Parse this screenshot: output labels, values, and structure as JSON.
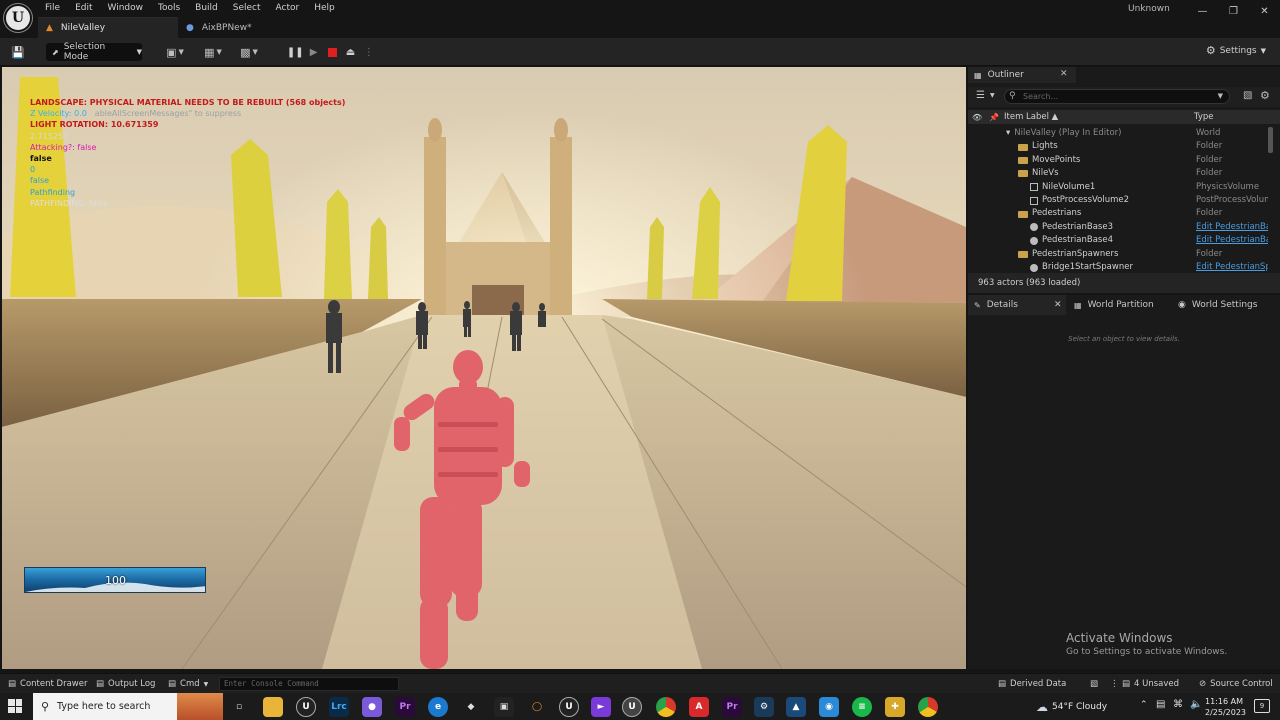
{
  "menu": {
    "items": [
      "File",
      "Edit",
      "Window",
      "Tools",
      "Build",
      "Select",
      "Actor",
      "Help"
    ],
    "window_title": "Unknown"
  },
  "tabs": [
    {
      "label": "NileValley",
      "active": true
    },
    {
      "label": "AixBPNew*",
      "active": false
    }
  ],
  "toolbar": {
    "selection_mode": "Selection Mode",
    "settings": "Settings"
  },
  "debug_messages": [
    {
      "text": "LANDSCAPE: PHYSICAL MATERIAL NEEDS TO BE REBUILT (568 objects)",
      "color": "#c21a1a",
      "weight": "bold"
    },
    {
      "text": "Z Velocity: 0.0",
      "color": "#3ab0e8",
      "suffix": "ableAllScreenMessages\" to suppress",
      "suffix_color": "#9aa0a8"
    },
    {
      "text": "LIGHT ROTATION: 10.671359",
      "color": "#c21a1a",
      "weight": "bold"
    },
    {
      "text": "2.715252",
      "color": "#d8d8d8"
    },
    {
      "text": "Attacking?: false",
      "color": "#d81ab8"
    },
    {
      "text": "false",
      "color": "#111111",
      "weight": "bold"
    },
    {
      "text": "0",
      "color": "#2a9fd8"
    },
    {
      "text": "false",
      "color": "#2a9fd8"
    },
    {
      "text": "Pathfinding",
      "color": "#2a9fd8"
    },
    {
      "text": "PATHFINDING: false",
      "color": "#dedede"
    }
  ],
  "health": {
    "value": "100"
  },
  "outliner": {
    "title": "Outliner",
    "search_placeholder": "Search...",
    "col_label": "Item Label",
    "col_type": "Type",
    "rows": [
      {
        "label": "NileValley (Play In Editor)",
        "type": "World",
        "indent": 0,
        "icon": "world",
        "dim": true
      },
      {
        "label": "Lights",
        "type": "Folder",
        "indent": 1,
        "icon": "folder"
      },
      {
        "label": "MovePoints",
        "type": "Folder",
        "indent": 1,
        "icon": "folder"
      },
      {
        "label": "NileVs",
        "type": "Folder",
        "indent": 1,
        "icon": "folder-open"
      },
      {
        "label": "NileVolume1",
        "type": "PhysicsVolume",
        "indent": 2,
        "icon": "vol"
      },
      {
        "label": "PostProcessVolume2",
        "type": "PostProcessVolum",
        "indent": 2,
        "icon": "vol"
      },
      {
        "label": "Pedestrians",
        "type": "Folder",
        "indent": 1,
        "icon": "folder-open"
      },
      {
        "label": "PedestrianBase3",
        "type": "Edit PedestrianBas",
        "indent": 2,
        "icon": "actor",
        "link": true
      },
      {
        "label": "PedestrianBase4",
        "type": "Edit PedestrianBas",
        "indent": 2,
        "icon": "actor",
        "link": true
      },
      {
        "label": "PedestrianSpawners",
        "type": "Folder",
        "indent": 1,
        "icon": "folder-open"
      },
      {
        "label": "Bridge1StartSpawner",
        "type": "Edit PedestrianSpa",
        "indent": 2,
        "icon": "actor",
        "link": true
      }
    ],
    "actors_count": "963 actors (963 loaded)"
  },
  "details": {
    "tabs": [
      "Details",
      "World Partition",
      "World Settings"
    ],
    "empty_text": "Select an object to view details."
  },
  "activation": {
    "title": "Activate Windows",
    "subtitle": "Go to Settings to activate Windows."
  },
  "bottombar": {
    "content_drawer": "Content Drawer",
    "output_log": "Output Log",
    "cmd": "Cmd",
    "console_placeholder": "Enter Console Command",
    "derived_data": "Derived Data",
    "unsaved": "4 Unsaved",
    "source_control": "Source Control"
  },
  "taskbar": {
    "search_placeholder": "Type here to search",
    "weather": "54°F  Cloudy",
    "time": "11:16 AM",
    "date": "2/25/2023",
    "notifications": "9"
  },
  "colors": {
    "accent": "#2a9fd8",
    "panel": "#1a1a1a",
    "toolbar": "#242424",
    "stop": "#e02020"
  }
}
